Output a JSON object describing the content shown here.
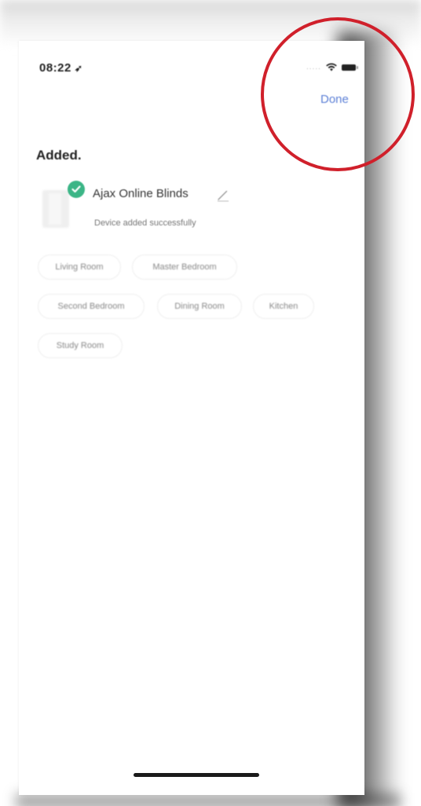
{
  "status_bar": {
    "time": "08:22",
    "signal_dots": "....."
  },
  "header": {
    "done_label": "Done"
  },
  "page": {
    "title": "Added."
  },
  "device": {
    "name": "Ajax Online Blinds",
    "status": "Device added successfully"
  },
  "rooms": [
    {
      "label": "Living Room"
    },
    {
      "label": "Master Bedroom"
    },
    {
      "label": "Second Bedroom"
    },
    {
      "label": "Dining Room"
    },
    {
      "label": "Kitchen"
    },
    {
      "label": "Study Room"
    }
  ],
  "colors": {
    "accent": "#5b7fd6",
    "success": "#3bb586",
    "annotation": "#d0202b"
  },
  "icons": {
    "location": "location-arrow-icon",
    "wifi": "wifi-icon",
    "battery": "battery-icon",
    "check": "check-circle-icon",
    "edit": "pencil-icon"
  }
}
